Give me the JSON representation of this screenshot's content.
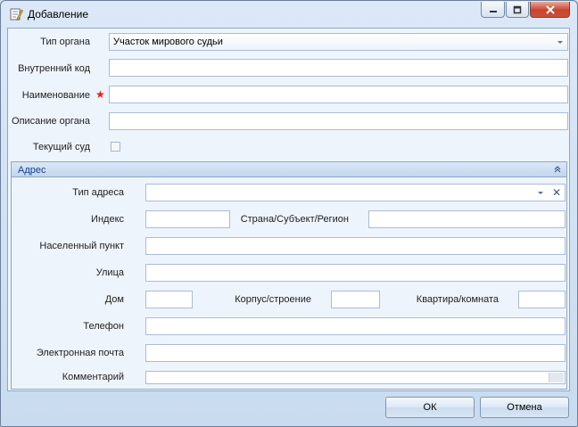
{
  "window": {
    "title": "Добавление",
    "icon": "edit-document-icon"
  },
  "form": {
    "organ_type": {
      "label": "Тип органа",
      "value": "Участок мирового судьи"
    },
    "internal_code": {
      "label": "Внутренний код",
      "value": ""
    },
    "name": {
      "label": "Наименование",
      "value": "",
      "required": true,
      "required_mark": "★"
    },
    "description": {
      "label": "Описание органа",
      "value": ""
    },
    "current_court": {
      "label": "Текущий суд",
      "checked": false
    }
  },
  "address": {
    "title": "Адрес",
    "address_type": {
      "label": "Тип адреса",
      "value": "",
      "clear_glyph": "✕"
    },
    "index": {
      "label": "Индекс",
      "value": ""
    },
    "country_region": {
      "label": "Страна/Субъект/Регион",
      "value": ""
    },
    "locality": {
      "label": "Населенный пункт",
      "value": ""
    },
    "street": {
      "label": "Улица",
      "value": ""
    },
    "house": {
      "label": "Дом",
      "value": ""
    },
    "building": {
      "label": "Корпус/строение",
      "value": ""
    },
    "apartment": {
      "label": "Квартира/комната",
      "value": ""
    },
    "phone": {
      "label": "Телефон",
      "value": ""
    },
    "email": {
      "label": "Электронная почта",
      "value": ""
    },
    "comment": {
      "label": "Комментарий",
      "value": ""
    }
  },
  "buttons": {
    "ok": "ОК",
    "cancel": "Отмена"
  },
  "colors": {
    "required": "#e02020",
    "section_title": "#15428b",
    "close_button": "#c9442e"
  }
}
